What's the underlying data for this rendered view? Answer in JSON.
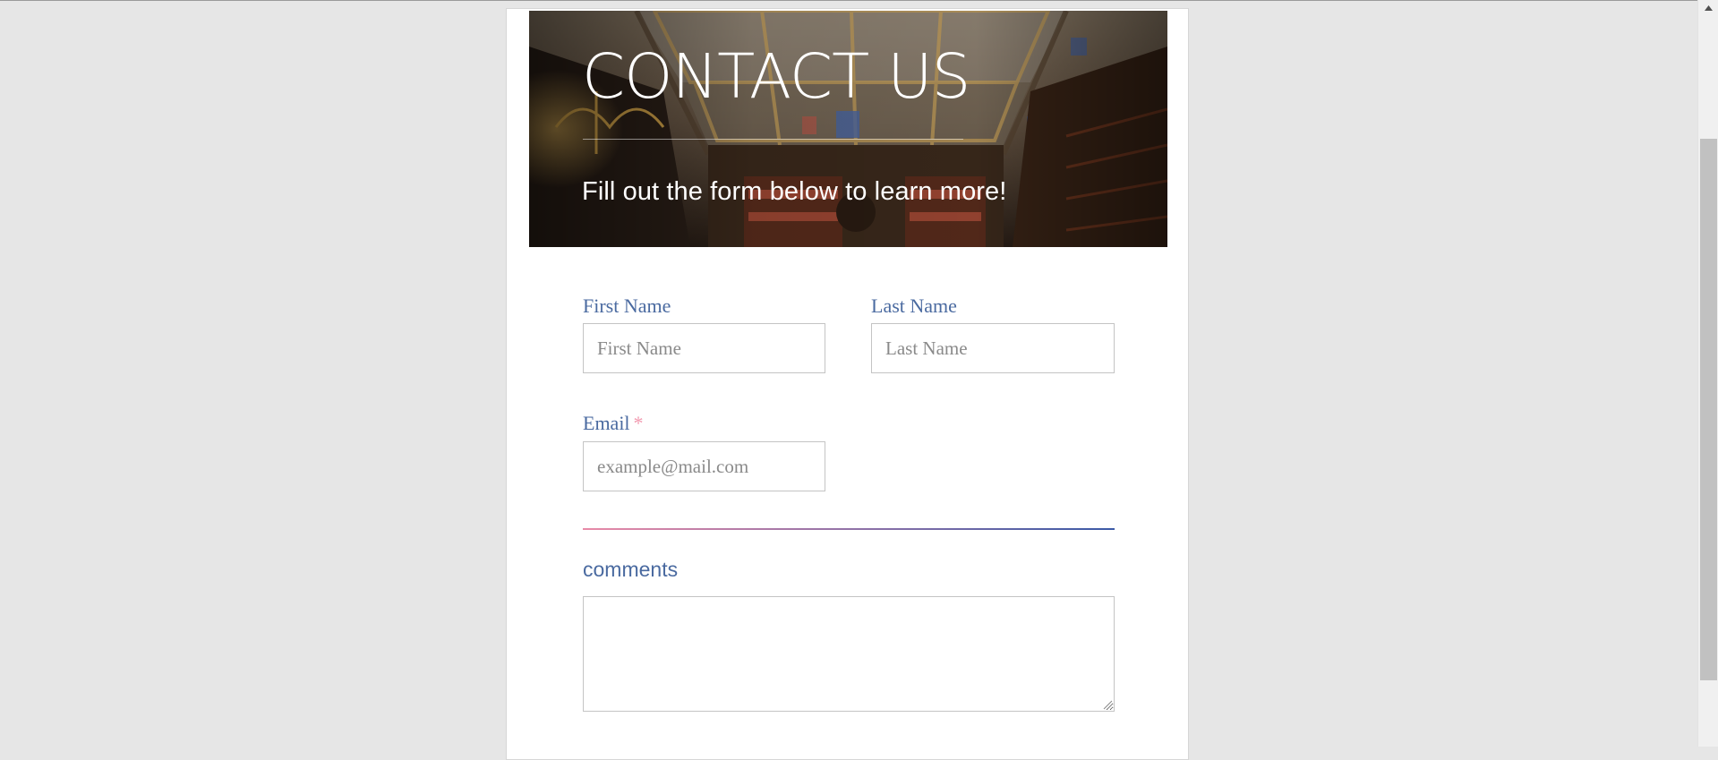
{
  "hero": {
    "title": "CONTACT US",
    "subtitle": "Fill out the form below to learn more!"
  },
  "form": {
    "first_name": {
      "label": "First Name",
      "placeholder": "First Name",
      "value": ""
    },
    "last_name": {
      "label": "Last Name",
      "placeholder": "Last Name",
      "value": ""
    },
    "email": {
      "label": "Email",
      "required_mark": "*",
      "placeholder": "example@mail.com",
      "value": ""
    },
    "comments": {
      "label": "comments",
      "value": ""
    }
  },
  "colors": {
    "page_background": "#e6e6e6",
    "label_text": "#4a6aa0",
    "required_mark": "#f29ab0",
    "divider_start": "#e88aa8",
    "divider_end": "#3b5aa6"
  },
  "icons": {
    "scroll_up": "triangle-up-icon",
    "resize_grip": "resize-grip-icon"
  }
}
